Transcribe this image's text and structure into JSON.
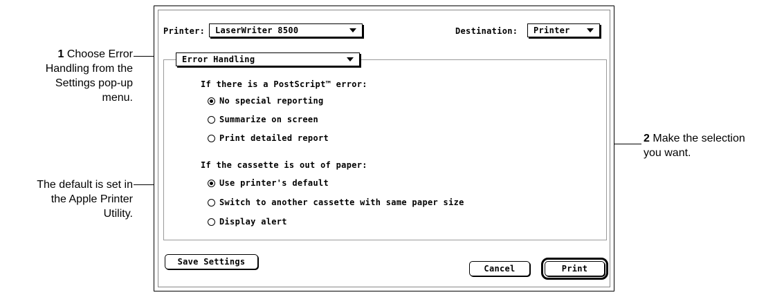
{
  "annotations": {
    "step1_num": "1",
    "step1_lines": [
      "Choose Error",
      "Handling from the",
      "Settings pop-up",
      "menu."
    ],
    "default_lines": [
      "The default is set in",
      "the Apple Printer",
      "Utility."
    ],
    "step2_num": "2",
    "step2_lines": [
      "Make the selection",
      "you want."
    ]
  },
  "dialog": {
    "printer_label": "Printer:",
    "printer_value": "LaserWriter 8500",
    "destination_label": "Destination:",
    "destination_value": "Printer",
    "settings_value": "Error Handling",
    "postscript_heading": "If there is a PostScript™ error:",
    "postscript_options": [
      {
        "label": "No special reporting",
        "selected": true
      },
      {
        "label": "Summarize on screen",
        "selected": false
      },
      {
        "label": "Print detailed report",
        "selected": false
      }
    ],
    "paper_heading": "If the cassette is out of paper:",
    "paper_options": [
      {
        "label": "Use printer's default",
        "selected": true
      },
      {
        "label": "Switch to another cassette with same paper size",
        "selected": false
      },
      {
        "label": "Display alert",
        "selected": false
      }
    ],
    "save_settings_label": "Save Settings",
    "cancel_label": "Cancel",
    "print_label": "Print"
  }
}
